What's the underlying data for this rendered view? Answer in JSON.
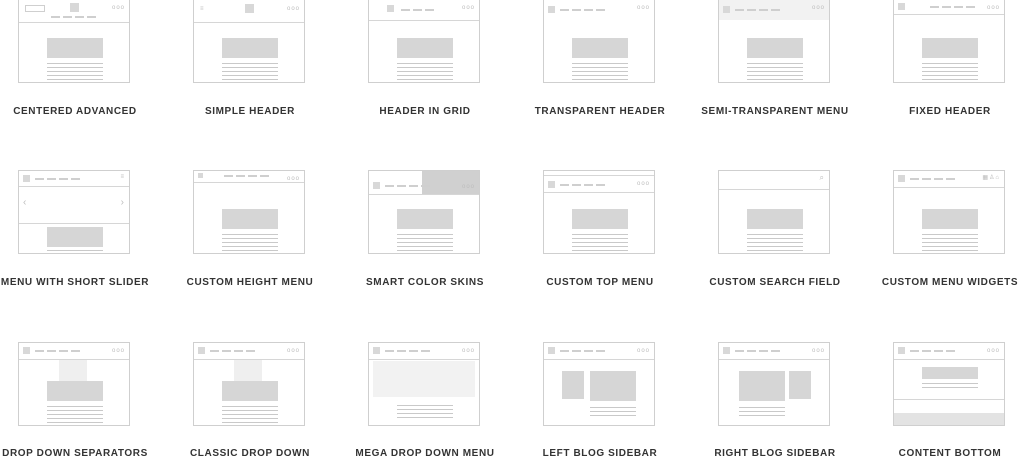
{
  "tiles": [
    {
      "key": "centered-advanced",
      "label": "CENTERED ADVANCED"
    },
    {
      "key": "simple-header",
      "label": "SIMPLE HEADER"
    },
    {
      "key": "header-in-grid",
      "label": "HEADER IN GRID"
    },
    {
      "key": "transparent-header",
      "label": "TRANSPARENT HEADER"
    },
    {
      "key": "semi-transparent-menu",
      "label": "SEMI-TRANSPARENT MENU"
    },
    {
      "key": "fixed-header",
      "label": "FIXED HEADER"
    },
    {
      "key": "menu-with-short-slider",
      "label": "MENU WITH SHORT SLIDER"
    },
    {
      "key": "custom-height-menu",
      "label": "CUSTOM HEIGHT MENU"
    },
    {
      "key": "smart-color-skins",
      "label": "SMART COLOR SKINS"
    },
    {
      "key": "custom-top-menu",
      "label": "CUSTOM TOP MENU"
    },
    {
      "key": "custom-search-field",
      "label": "CUSTOM SEARCH FIELD"
    },
    {
      "key": "custom-menu-widgets",
      "label": "CUSTOM MENU WIDGETS"
    },
    {
      "key": "drop-down-separators",
      "label": "DROP DOWN SEPARATORS"
    },
    {
      "key": "classic-drop-down",
      "label": "CLASSIC DROP DOWN"
    },
    {
      "key": "mega-drop-down-menu",
      "label": "MEGA DROP DOWN MENU"
    },
    {
      "key": "left-blog-sidebar",
      "label": "LEFT BLOG SIDEBAR"
    },
    {
      "key": "right-blog-sidebar",
      "label": "RIGHT BLOG SIDEBAR"
    },
    {
      "key": "content-bottom",
      "label": "CONTENT BOTTOM"
    }
  ],
  "icons": {
    "dots": "ooo",
    "menu": "≡",
    "search": "⌕",
    "widgets": "▦♙⌂",
    "arrow_left": "‹",
    "arrow_right": "›"
  }
}
